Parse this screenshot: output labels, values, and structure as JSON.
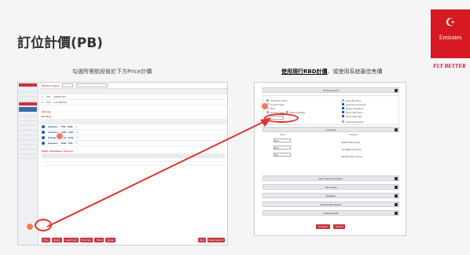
{
  "slide": {
    "title": "訂位計價(PB)",
    "left_caption": "勾選所需航段後於下方Price計價",
    "right_caption_bold": "使用現行RBD計價",
    "right_caption_rest": "、或使用系統最佳售價",
    "brand": {
      "name": "Emirates",
      "tagline": "FLY BETTER",
      "red": "#d71921"
    }
  },
  "left_screen": {
    "record_locator_label": "Record Locator",
    "sections": {
      "itinerary": "Itinerary",
      "booking": "Booking",
      "bookings": "Bookings",
      "flight_remarks": "Flight / Remittance Services"
    },
    "segments": [
      {
        "airline": "Emirates",
        "code": "TPE - DXB",
        "cabin": "Y"
      },
      {
        "airline": "Emirates",
        "code": "DXB - CDG",
        "cabin": "Y"
      },
      {
        "airline": "Emirates",
        "code": "CDG - DXB",
        "cabin": "Y"
      },
      {
        "airline": "Emirates",
        "code": "DXB - TPE",
        "cabin": "Y"
      }
    ],
    "passengers": [
      {
        "no": "1",
        "type": "ADT",
        "last": "EMIRATES"
      },
      {
        "no": "2",
        "type": "ADT",
        "last": "LAURENCE"
      }
    ],
    "buttons": [
      "Price",
      "Modify",
      "Credit Card",
      "Pay Fare",
      "Ticket",
      "Queue"
    ],
    "right_buttons": [
      "Void",
      "Reset Record"
    ],
    "accent": "#c8343b"
  },
  "right_screen": {
    "pricing_options": "Pricing Options",
    "options": [
      "Published Fares",
      "Private Fares",
      "Both",
      "Current Class",
      "Best Available"
    ],
    "checkboxes": [
      "Expedia Fares",
      "Advance and Extra",
      "Return Penalties",
      "Show Net Fares",
      "Show Max Stay"
    ],
    "select_value": "INF",
    "historical": "Historical Pricing",
    "travelers": "Travelers",
    "traveler_rows": [
      {
        "type": "ADT",
        "name": "EMIRATES SAGA"
      },
      {
        "type": "ADT",
        "name": "LAURENCE SAGA"
      },
      {
        "type": "INF",
        "name": "INFANT MAY SAGA"
      }
    ],
    "type_header": "Type",
    "traveler_header": "Traveler",
    "collapsed": [
      "Fare Selection Options",
      "Tour Codes",
      "Qualifiers",
      "Tax Exempt Options",
      "Endorse Field"
    ],
    "buttons": [
      "Continue",
      "Cancel"
    ]
  },
  "markers": {
    "color": "#ec7b5e"
  }
}
